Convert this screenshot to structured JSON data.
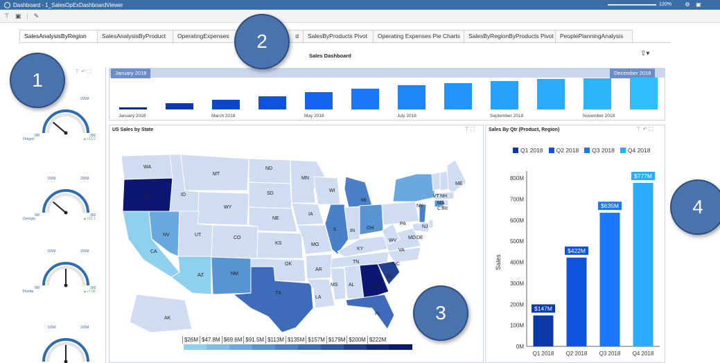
{
  "window": {
    "title": "Dashboard - 1_SalesOpExDashboardViewer",
    "zoom": "120%"
  },
  "toolbar": {
    "icons": [
      "filter-icon",
      "save-icon",
      "edit-icon"
    ]
  },
  "tabs": [
    {
      "label": "SalesAnalysisByRegion",
      "active": true
    },
    {
      "label": "SalesAnalysisByProduct",
      "active": false
    },
    {
      "label": "OperatingExpenses",
      "active": false
    },
    {
      "label": "d",
      "active": false
    },
    {
      "label": "SalesByProducts Pivot",
      "active": false
    },
    {
      "label": "Operating Expenses Pie Charts",
      "active": false
    },
    {
      "label": "SalesByRegionByProducts Pivot",
      "active": false
    },
    {
      "label": "PeoplePlanningAnalysis",
      "active": false
    }
  ],
  "dashboard": {
    "title": "Sales Dashboard"
  },
  "left_panel": {
    "title_fragment": "Ta",
    "gauges": [
      {
        "state": "Oregon",
        "delta": "▲+13.2",
        "min": "0M",
        "mid": "100M",
        "max": "200M",
        "end": "300",
        "needle_deg": 40
      },
      {
        "state": "Georgia",
        "delta": "▲+12.1",
        "min": "0M",
        "mid": "100M",
        "max": "200M",
        "end": "300",
        "needle_deg": 40
      },
      {
        "state": "Florida",
        "delta": "▲+7.08",
        "min": "0M",
        "mid": "100M",
        "max": "200M",
        "end": "300",
        "needle_deg": 90
      },
      {
        "state": "",
        "delta": "",
        "min": "",
        "mid": "100M",
        "max": "200M",
        "end": "",
        "needle_deg": 90
      }
    ]
  },
  "timeline": {
    "start_label": "January 2018",
    "end_label": "December 2018",
    "axis_labels": [
      "January 2018",
      "March 2018",
      "May 2018",
      "July 2018",
      "September 2018",
      "November 2018"
    ],
    "bar_relative_heights": [
      0.07,
      0.2,
      0.3,
      0.41,
      0.54,
      0.66,
      0.76,
      0.83,
      0.9,
      0.95,
      0.98,
      1.0
    ],
    "bar_colors": [
      "#0a2a8a",
      "#0b3aa8",
      "#0d47c7",
      "#0f52dc",
      "#1463f0",
      "#1a77f7",
      "#1f86f8",
      "#2394f9",
      "#27a2fa",
      "#2aacfb",
      "#2db5fb",
      "#30bdfc"
    ]
  },
  "map": {
    "title": "US Sales by State",
    "legend": [
      "$26M",
      "$47.8M",
      "$69.6M",
      "$91.5M",
      "$113M",
      "$135M",
      "$157M",
      "$179M",
      "$200M",
      "$222M"
    ],
    "legend_colors": [
      "#8fd0ef",
      "#7dbde8",
      "#6aa9df",
      "#5893d2",
      "#4a80c8",
      "#3e6cbb",
      "#2f57a8",
      "#233f92",
      "#15287b",
      "#0b1770"
    ],
    "state_labels": [
      "WA",
      "MT",
      "ND",
      "MN",
      "ME",
      "OR",
      "ID",
      "SD",
      "WI",
      "MI",
      "NY",
      "VT",
      "NH",
      "MA",
      "CT",
      "RI",
      "WY",
      "NE",
      "IA",
      "IL",
      "IN",
      "OH",
      "PA",
      "NJ",
      "MD",
      "DE",
      "NV",
      "UT",
      "CO",
      "KS",
      "MO",
      "KY",
      "WV",
      "VA",
      "CA",
      "OK",
      "TN",
      "NC",
      "AZ",
      "NM",
      "AR",
      "SC",
      "MS",
      "AL",
      "GA",
      "TX",
      "LA",
      "FL",
      "AK"
    ]
  },
  "qtr_chart": {
    "title": "Sales By Qtr (Product, Region)",
    "chart_data": {
      "type": "bar",
      "title": "Sales By Qtr (Product, Region)",
      "categories": [
        "Q1 2018",
        "Q2 2018",
        "Q3 2018",
        "Q4 2018"
      ],
      "values": [
        147,
        422,
        635,
        777
      ],
      "value_labels": [
        "$147M",
        "$422M",
        "$635M",
        "$777M"
      ],
      "colors": [
        "#0b3aa8",
        "#0f52dc",
        "#1a77f7",
        "#2aacfb"
      ],
      "legend": [
        "Q1 2018",
        "Q2 2018",
        "Q3 2018",
        "Q4 2018"
      ],
      "ylabel": "Sales",
      "ylim": [
        0,
        800
      ],
      "yticks": [
        "0M",
        "100M",
        "200M",
        "300M",
        "400M",
        "500M",
        "600M",
        "700M",
        "800M"
      ]
    }
  },
  "callouts": [
    "1",
    "2",
    "3",
    "4"
  ]
}
